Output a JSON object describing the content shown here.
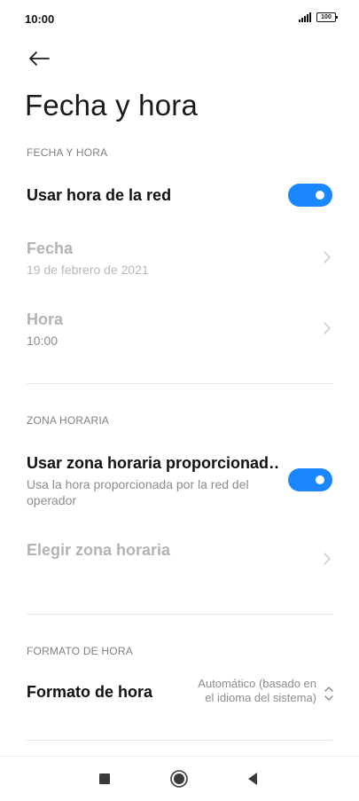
{
  "status_bar": {
    "time": "10:00",
    "battery": "100"
  },
  "page": {
    "title": "Fecha y hora"
  },
  "sections": {
    "date_time": {
      "header": "FECHA Y HORA",
      "network_time": {
        "label": "Usar hora de la red",
        "enabled": true
      },
      "date": {
        "label": "Fecha",
        "value": "19 de febrero de 2021"
      },
      "time": {
        "label": "Hora",
        "value": "10:00"
      }
    },
    "time_zone": {
      "header": "ZONA HORARIA",
      "network_zone": {
        "label": "Usar zona horaria proporcionad…",
        "description": "Usa la hora proporcionada por la red del operador",
        "enabled": true
      },
      "choose_zone": {
        "label": "Elegir zona horaria"
      }
    },
    "time_format": {
      "header": "FORMATO DE HORA",
      "format": {
        "label": "Formato de hora",
        "value": "Automático (basado en el idioma del sistema)"
      }
    }
  },
  "colors": {
    "accent": "#1b87ff",
    "disabled_text": "#b3b3b3"
  },
  "icons": {
    "back": "back-arrow-icon",
    "chevron": "chevron-right-icon",
    "dropdown": "up-down-chevron-icon",
    "nav_recents": "square-icon",
    "nav_home": "circle-icon",
    "nav_back": "triangle-icon"
  }
}
